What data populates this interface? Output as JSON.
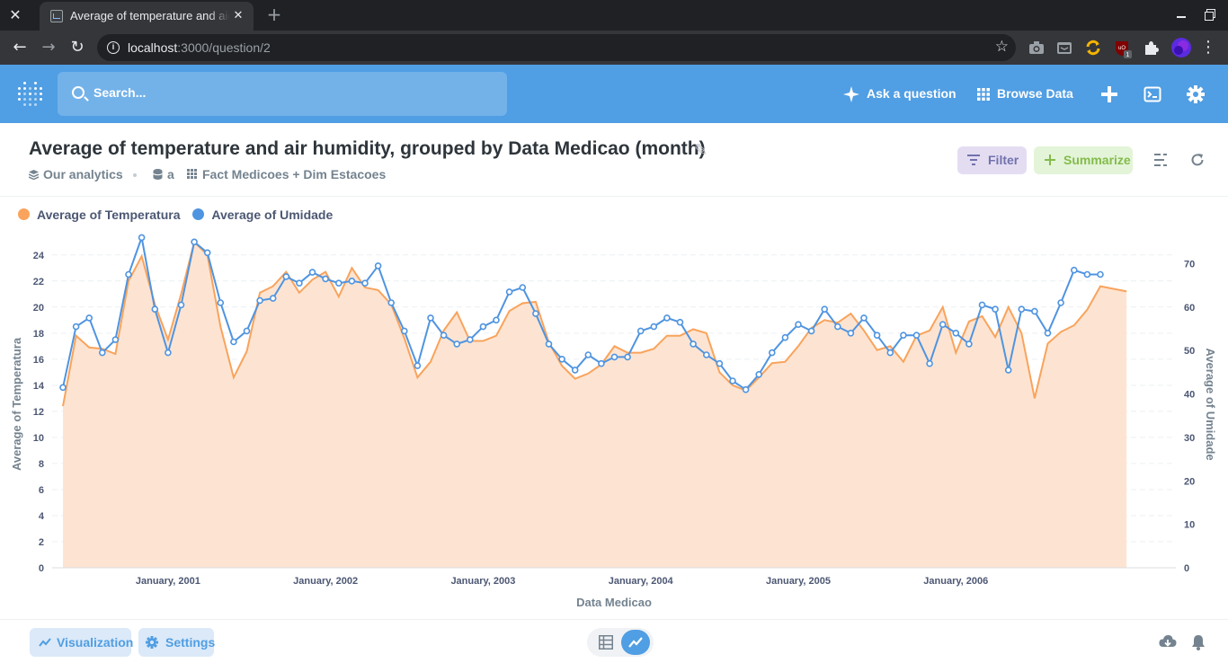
{
  "browser": {
    "tab_title": "Average of temperature and air humidity, grouped by Data Medicao (month)",
    "url_host": "localhost",
    "url_path": ":3000/question/2",
    "extension_badge": "1"
  },
  "nav": {
    "search_placeholder": "Search...",
    "ask_question": "Ask a question",
    "browse_data": "Browse Data"
  },
  "question": {
    "title": "Average of temperature and air humidity, grouped by Data Medicao (month)",
    "collection": "Our analytics",
    "database": "a",
    "tables": "Fact Medicoes + Dim Estacoes",
    "filter_label": "Filter",
    "summarize_label": "Summarize"
  },
  "footer": {
    "visualization_label": "Visualization",
    "settings_label": "Settings"
  },
  "colors": {
    "brand": "#509ee3",
    "temperature": "#f9a35c",
    "temperature_fill": "#fde4d2",
    "humidity": "#4f94e0"
  },
  "chart_data": {
    "type": "area",
    "xlabel": "Data Medicao",
    "ylabel_left": "Average of Temperatura",
    "ylabel_right": "Average of Umidade",
    "ylim_left": [
      0,
      25.5
    ],
    "yticks_left": [
      0,
      2,
      4,
      6,
      8,
      10,
      12,
      14,
      16,
      18,
      20,
      22,
      24
    ],
    "ylim_right": [
      0,
      76.5
    ],
    "yticks_right": [
      0,
      10,
      20,
      30,
      40,
      50,
      60,
      70
    ],
    "x_tick_labels": [
      "January, 2001",
      "January, 2002",
      "January, 2003",
      "January, 2004",
      "January, 2005",
      "January, 2006"
    ],
    "x_tick_months": [
      "2001-01",
      "2002-01",
      "2003-01",
      "2004-01",
      "2005-01",
      "2006-01"
    ],
    "x": [
      "2000-05",
      "2000-06",
      "2000-07",
      "2000-08",
      "2000-09",
      "2000-10",
      "2000-11",
      "2000-12",
      "2001-01",
      "2001-02",
      "2001-03",
      "2001-04",
      "2001-05",
      "2001-06",
      "2001-07",
      "2001-08",
      "2001-09",
      "2001-10",
      "2001-11",
      "2001-12",
      "2002-01",
      "2002-02",
      "2002-03",
      "2002-04",
      "2002-05",
      "2002-06",
      "2002-07",
      "2002-08",
      "2002-09",
      "2002-10",
      "2002-11",
      "2002-12",
      "2003-01",
      "2003-02",
      "2003-03",
      "2003-04",
      "2003-05",
      "2003-06",
      "2003-07",
      "2003-08",
      "2003-09",
      "2003-10",
      "2003-11",
      "2003-12",
      "2004-01",
      "2004-02",
      "2004-03",
      "2004-04",
      "2004-05",
      "2004-06",
      "2004-07",
      "2004-08",
      "2004-09",
      "2004-10",
      "2004-11",
      "2004-12",
      "2005-01",
      "2005-02",
      "2005-03",
      "2005-04",
      "2005-05",
      "2005-06",
      "2005-07",
      "2005-08",
      "2005-09",
      "2005-10",
      "2005-11",
      "2005-12",
      "2006-01",
      "2006-02",
      "2006-03",
      "2006-04",
      "2006-05",
      "2006-06",
      "2006-07",
      "2006-08",
      "2006-09",
      "2006-10",
      "2006-11",
      "2006-12",
      "2007-01",
      "2007-02",
      "2007-03",
      "2007-04",
      "2007-05"
    ],
    "series": [
      {
        "name": "Average of Temperatura",
        "color": "#f9a35c",
        "fill": "area",
        "values": [
          12.4,
          17.8,
          16.9,
          16.8,
          16.4,
          22.0,
          23.9,
          20.2,
          17.5,
          21.0,
          25.0,
          24.0,
          18.5,
          14.6,
          16.6,
          21.1,
          21.6,
          22.7,
          21.1,
          22.1,
          22.7,
          20.8,
          23.0,
          21.5,
          21.3,
          20.2,
          17.6,
          14.6,
          15.8,
          18.2,
          19.6,
          17.4,
          17.4,
          17.8,
          19.7,
          20.3,
          20.4,
          17.3,
          15.5,
          14.5,
          14.9,
          15.6,
          17.0,
          16.5,
          16.5,
          16.8,
          17.8,
          17.8,
          18.3,
          18.0,
          15.0,
          14.0,
          13.6,
          14.6,
          15.7,
          15.8,
          17.0,
          18.4,
          19.0,
          18.8,
          19.5,
          18.2,
          16.7,
          17.0,
          15.8,
          17.8,
          18.2,
          20.0,
          16.5,
          18.9,
          19.3,
          17.7,
          20.0,
          18.0,
          13.0,
          17.2,
          18.1,
          18.6,
          19.8,
          21.6,
          21.4,
          21.2
        ]
      },
      {
        "name": "Average of Umidade",
        "color": "#4f94e0",
        "fill": "none",
        "values": [
          41.5,
          55.5,
          57.5,
          49.5,
          52.5,
          67.5,
          76.0,
          59.5,
          49.5,
          60.5,
          75.0,
          72.5,
          61.0,
          52.0,
          54.5,
          61.5,
          62.0,
          67.0,
          65.5,
          68.0,
          66.5,
          65.5,
          66.0,
          65.5,
          69.5,
          61.0,
          54.5,
          46.5,
          57.5,
          53.5,
          51.5,
          52.5,
          55.5,
          57.0,
          63.5,
          64.5,
          58.5,
          51.5,
          48.0,
          45.5,
          49.0,
          47.0,
          48.5,
          48.5,
          54.5,
          55.5,
          57.5,
          56.5,
          51.5,
          49.0,
          47.0,
          43.0,
          41.0,
          44.5,
          49.5,
          53.0,
          56.0,
          54.5,
          59.5,
          55.5,
          54.0,
          57.5,
          53.5,
          49.5,
          53.5,
          53.5,
          47.0,
          56.0,
          54.0,
          51.5,
          60.5,
          59.5,
          45.5,
          59.5,
          59.0,
          54.0,
          61.0,
          68.5,
          67.5,
          67.5
        ]
      }
    ]
  }
}
